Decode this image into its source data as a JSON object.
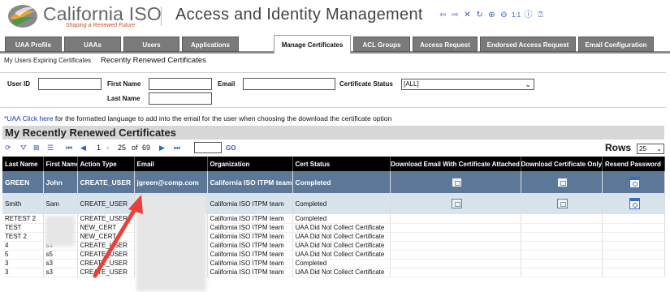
{
  "brand": {
    "name": "California ISO",
    "tagline": "Shaping a Renewed Future"
  },
  "app_title": "Access and Identity Management",
  "toolbar": {
    "icons": [
      "back-arrow-icon",
      "forward-arrow-icon",
      "close-icon",
      "refresh-icon",
      "zoom-in-icon",
      "zoom-out-icon",
      "actual-size-icon",
      "info-icon",
      "help-icon"
    ],
    "actual_size_label": "1:1"
  },
  "tabs": [
    {
      "label": "UAA Profile",
      "active": false
    },
    {
      "label": "UAAs",
      "active": false
    },
    {
      "label": "Users",
      "active": false
    },
    {
      "label": "Applications",
      "active": false
    },
    {
      "label": "Manage Certificates",
      "active": true
    },
    {
      "label": "ACL Groups",
      "active": false
    },
    {
      "label": "Access Request",
      "active": false
    },
    {
      "label": "Endorsed Access Request",
      "active": false
    },
    {
      "label": "Email Configuration",
      "active": false
    }
  ],
  "subnav": {
    "link1": "My Users Expiring Certificates",
    "current": "Recently Renewed Certificates"
  },
  "filters": {
    "user_id_label": "User ID",
    "first_name_label": "First Name",
    "last_name_label": "Last Name",
    "email_label": "Email",
    "status_label": "Certificate Status",
    "status_value": "[ALL]"
  },
  "uaa_note": {
    "link": "*UAA Click here",
    "text": " for the formatted language to add into the email for the user when choosing the download the certificate option"
  },
  "grid": {
    "title": "My Recently Renewed Certificates",
    "pager": {
      "page": "1",
      "dash": "-",
      "to": "25",
      "of_label": "of",
      "total": "69",
      "go": "GO",
      "rows_label": "Rows",
      "rows_value": "25"
    },
    "columns": [
      "Last Name",
      "First Name",
      "Action Type",
      "Email",
      "Organization",
      "Cert Status",
      "Download Email With Certificate Attached",
      "Download Certificate Only",
      "Resend Password"
    ],
    "rows": [
      {
        "last": "GREEN",
        "first": "John",
        "action": "CREATE_USER",
        "email": "jgreen@comp.com",
        "org": "California ISO ITPM team",
        "status": "Completed",
        "icons": true
      },
      {
        "last": "Smith",
        "first": "Sam",
        "action": "CREATE_USER",
        "email": "",
        "org": "California ISO ITPM team",
        "status": "Completed",
        "icons": true
      },
      {
        "last": "RETEST 2",
        "first": "",
        "action": "CREATE_USER",
        "email": "",
        "org": "California ISO ITPM team",
        "status": "Completed",
        "icons": false
      },
      {
        "last": "TEST",
        "first": "",
        "action": "NEW_CERT",
        "email": "",
        "org": "California ISO ITPM team",
        "status": "UAA Did Not Collect Certificate",
        "icons": false
      },
      {
        "last": "TEST 2",
        "first": "",
        "action": "NEW_CERT",
        "email": "",
        "org": "California ISO ITPM team",
        "status": "UAA Did Not Collect Certificate",
        "icons": false
      },
      {
        "last": "4",
        "first": "s4",
        "action": "CREATE_USER",
        "email": "",
        "org": "California ISO ITPM team",
        "status": "UAA Did Not Collect Certificate",
        "icons": false
      },
      {
        "last": "5",
        "first": "s5",
        "action": "CREATE_USER",
        "email": "",
        "org": "California ISO ITPM team",
        "status": "UAA Did Not Collect Certificate",
        "icons": false
      },
      {
        "last": "3",
        "first": "s3",
        "action": "CREATE_USER",
        "email": "",
        "org": "California ISO ITPM team",
        "status": "Completed",
        "icons": false
      },
      {
        "last": "3",
        "first": "s3",
        "action": "CREATE_USER",
        "email": "",
        "org": "California ISO ITPM team",
        "status": "UAA Did Not Collect Certificate",
        "icons": false
      }
    ]
  },
  "colors": {
    "selected_row": "#5b7898",
    "alt_row": "#d9e3ec",
    "tab_bg": "#7a7a7a",
    "annotation_arrow": "#e8413a"
  }
}
